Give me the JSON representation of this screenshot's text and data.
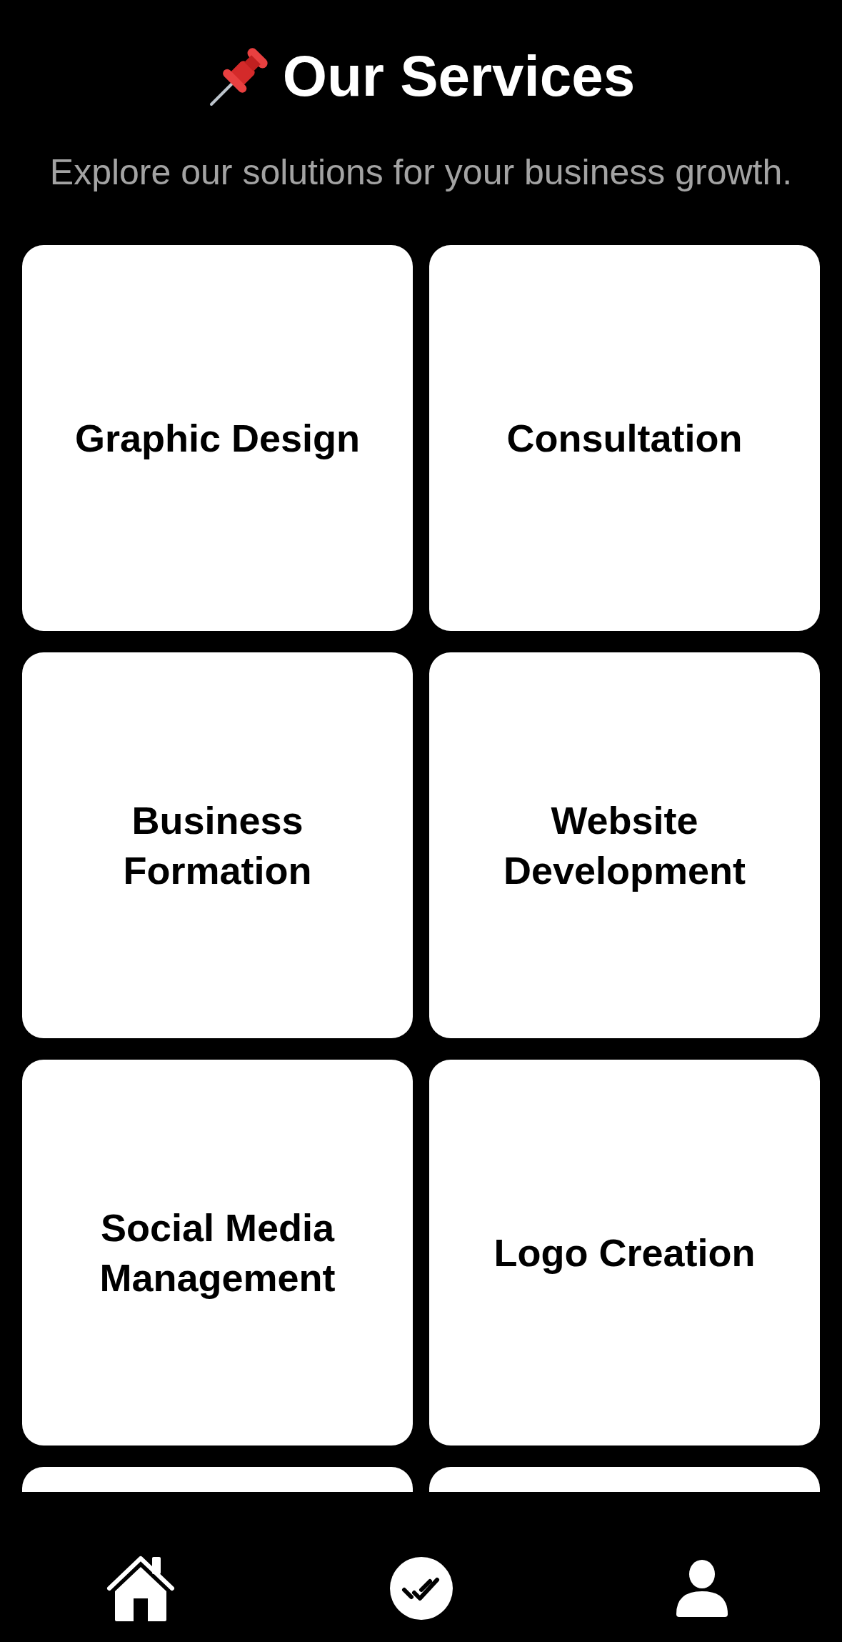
{
  "header": {
    "title": "Our Services",
    "subtitle": "Explore our solutions for your business growth."
  },
  "services": [
    {
      "kind": "service",
      "title": "Graphic Design"
    },
    {
      "kind": "service",
      "title": "Consultation"
    },
    {
      "kind": "service",
      "title": "Business Formation"
    },
    {
      "kind": "service",
      "title": "Website Development"
    },
    {
      "kind": "service",
      "title": "Social Media Management"
    },
    {
      "kind": "service",
      "title": "Logo Creation"
    },
    {
      "kind": "partial"
    },
    {
      "kind": "partial"
    }
  ],
  "tab_bar": [
    {
      "kind": "home"
    },
    {
      "kind": "tasks"
    },
    {
      "kind": "profile"
    }
  ]
}
